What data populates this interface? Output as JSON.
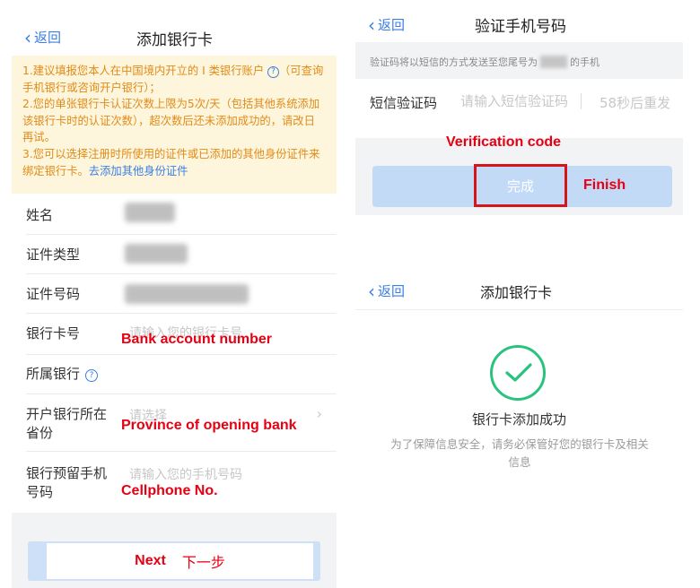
{
  "left": {
    "back_label": "返回",
    "title": "添加银行卡",
    "notice": {
      "line1_a": "1.建议填报您本人在中国境内开立的 I 类银行账户",
      "line1_b": "（可查询手机银行或咨询开户银行）；",
      "line2": "2.您的单张银行卡认证次数上限为5次/天（包括其他系统添加该银行卡时的认证次数），超次数后还未添加成功的，请改日再试。",
      "line3_a": "3.您可以选择注册时所使用的证件或已添加的其他身份证件来绑定银行卡。",
      "line3_link": "去添加其他身份证件"
    },
    "form": {
      "name_label": "姓名",
      "id_type_label": "证件类型",
      "id_number_label": "证件号码",
      "card_label": "银行卡号",
      "card_placeholder": "请输入您的银行卡号",
      "bank_label": "所属银行",
      "province_label_1": "开户银行所在",
      "province_label_2": "省份",
      "province_placeholder": "请选择",
      "phone_label_1": "银行预留手机",
      "phone_label_2": "号码",
      "phone_placeholder": "请输入您的手机号码"
    },
    "annotations": {
      "card": "Bank account number",
      "province": "Province of opening bank",
      "phone": "Cellphone No."
    },
    "next": {
      "en": "Next",
      "cn": "下一步"
    }
  },
  "verify": {
    "back_label": "返回",
    "title": "验证手机号码",
    "hint_a": "验证码将以短信的方式发送至您尾号为",
    "hint_b": "的手机",
    "sms_label": "短信验证码",
    "sms_placeholder": "请输入短信验证码",
    "resend": "58秒后重发",
    "annot_code": "Verification code",
    "done": "完成",
    "annot_finish": "Finish"
  },
  "success": {
    "back_label": "返回",
    "title": "添加银行卡",
    "message": "银行卡添加成功",
    "desc": "为了保障信息安全，请务必保管好您的银行卡及相关信息"
  },
  "colors": {
    "accent": "#3a7ee4",
    "annotation": "#e60012",
    "success": "#29c27f",
    "notice_text": "#e28a18"
  }
}
